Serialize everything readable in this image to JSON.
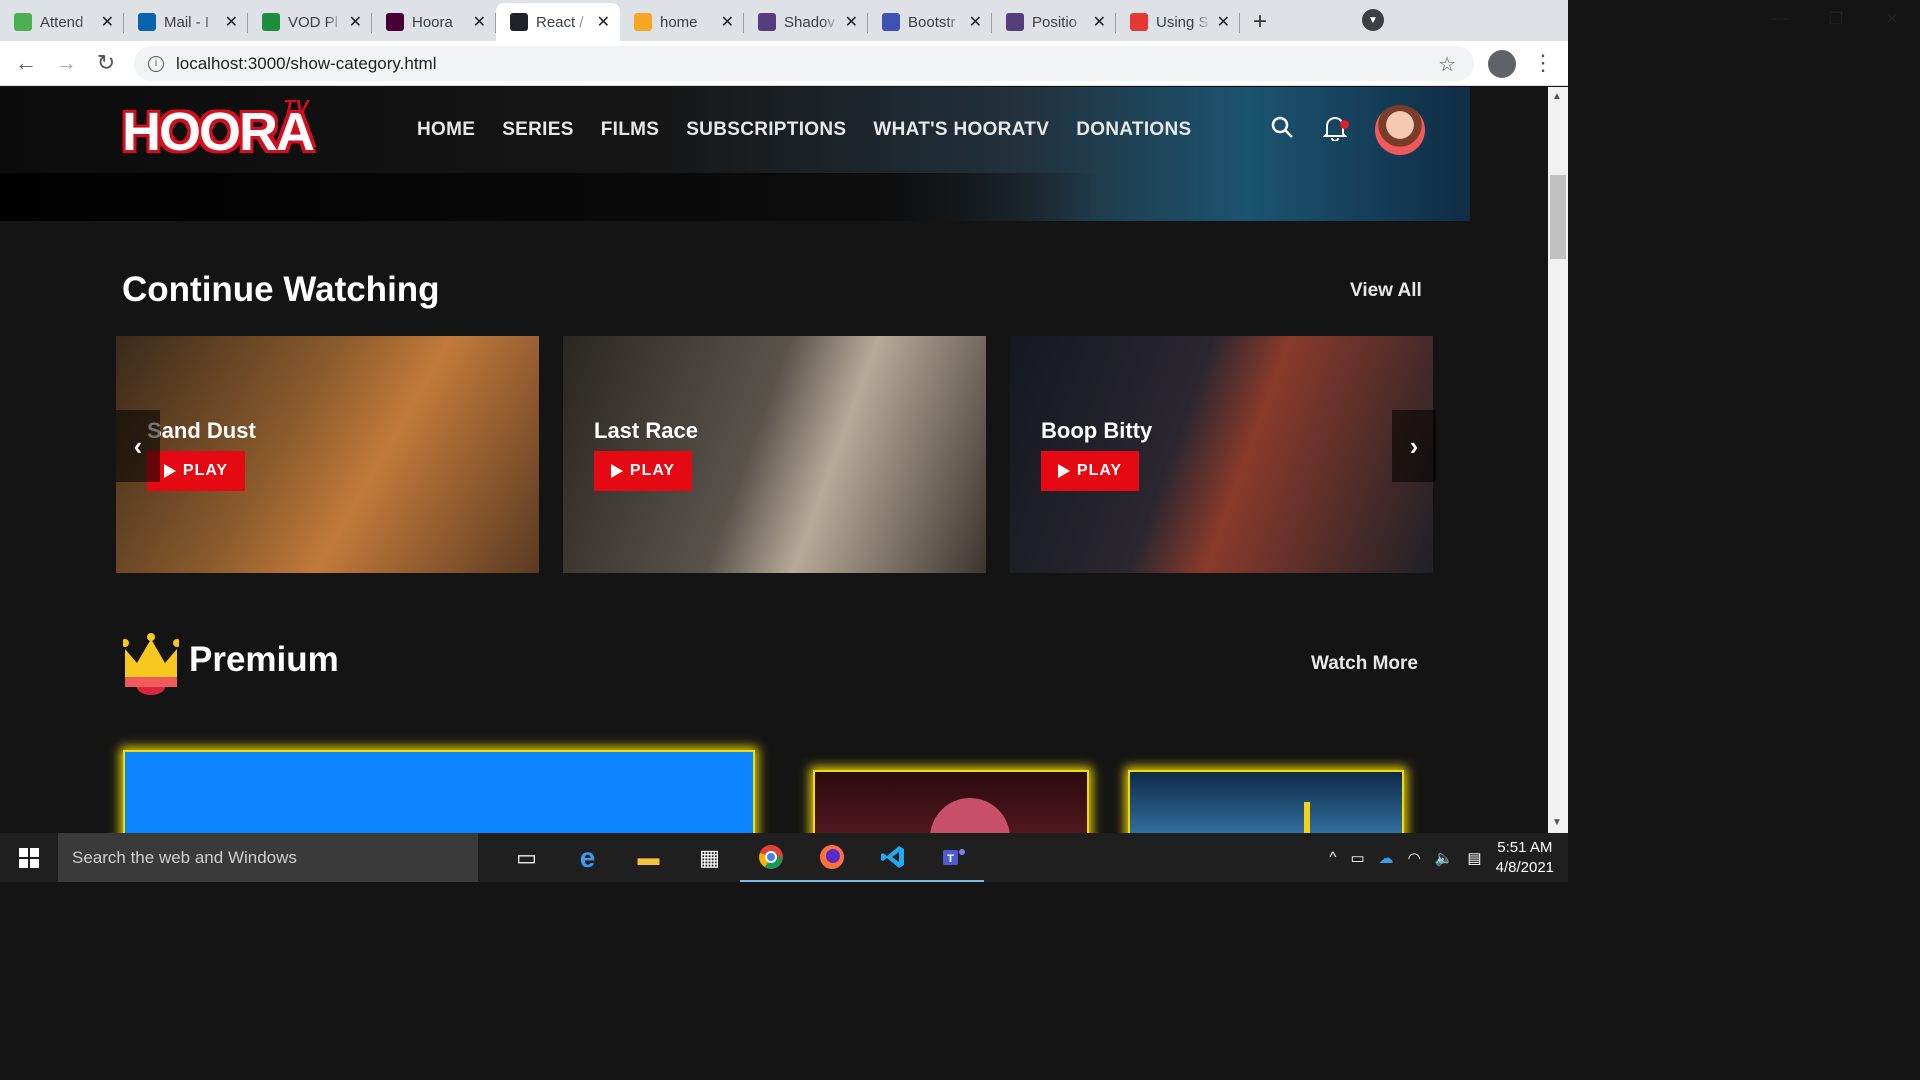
{
  "browser": {
    "tabs": [
      {
        "title": "Attend",
        "icon": "attend-icon",
        "color": "#4caf50"
      },
      {
        "title": "Mail - I",
        "icon": "outlook-icon",
        "color": "#0a64ad"
      },
      {
        "title": "VOD Pl",
        "icon": "vod-icon",
        "color": "#1e8e3e"
      },
      {
        "title": "Hoora",
        "icon": "xd-icon",
        "color": "#470137"
      },
      {
        "title": "React /",
        "icon": "react-icon",
        "color": "#20232a",
        "active": true
      },
      {
        "title": "home",
        "icon": "home-icon",
        "color": "#f5a623"
      },
      {
        "title": "Shadov",
        "icon": "bootstrap-icon",
        "color": "#563d7c"
      },
      {
        "title": "Bootstr",
        "icon": "mdb-icon",
        "color": "#3f51b5"
      },
      {
        "title": "Positio",
        "icon": "bootstrap-icon",
        "color": "#563d7c"
      },
      {
        "title": "Using S",
        "icon": "asterisk-icon",
        "color": "#e53935"
      }
    ],
    "url": "localhost:3000/show-category.html"
  },
  "site": {
    "logo": "HOORA",
    "logo_tv": "TV",
    "nav": [
      "HOME",
      "SERIES",
      "FILMS",
      "SUBSCRIPTIONS",
      "WHAT'S HOORATV",
      "DONATIONS"
    ]
  },
  "continue": {
    "title": "Continue Watching",
    "view_all": "View All",
    "cards": [
      {
        "title": "Sand Dust",
        "play": "PLAY",
        "bg": "linear-gradient(120deg,#3a2a1a 0%,#8a5a2c 40%,#c27a3a 60%,#5a3a22 100%)"
      },
      {
        "title": "Last Race",
        "play": "PLAY",
        "bg": "linear-gradient(110deg,#2a2622 0%,#5a534c 45%,#b8aa98 62%,#3c3530 100%)"
      },
      {
        "title": "Boop Bitty",
        "play": "PLAY",
        "bg": "linear-gradient(110deg,#141820 0%,#2a2630 40%,#8a3a2a 55%,#1e2028 100%)"
      }
    ]
  },
  "premium": {
    "title": "Premium",
    "watch_more": "Watch More"
  },
  "taskbar": {
    "search_placeholder": "Search the web and Windows",
    "time": "5:51 AM",
    "date": "4/8/2021"
  }
}
